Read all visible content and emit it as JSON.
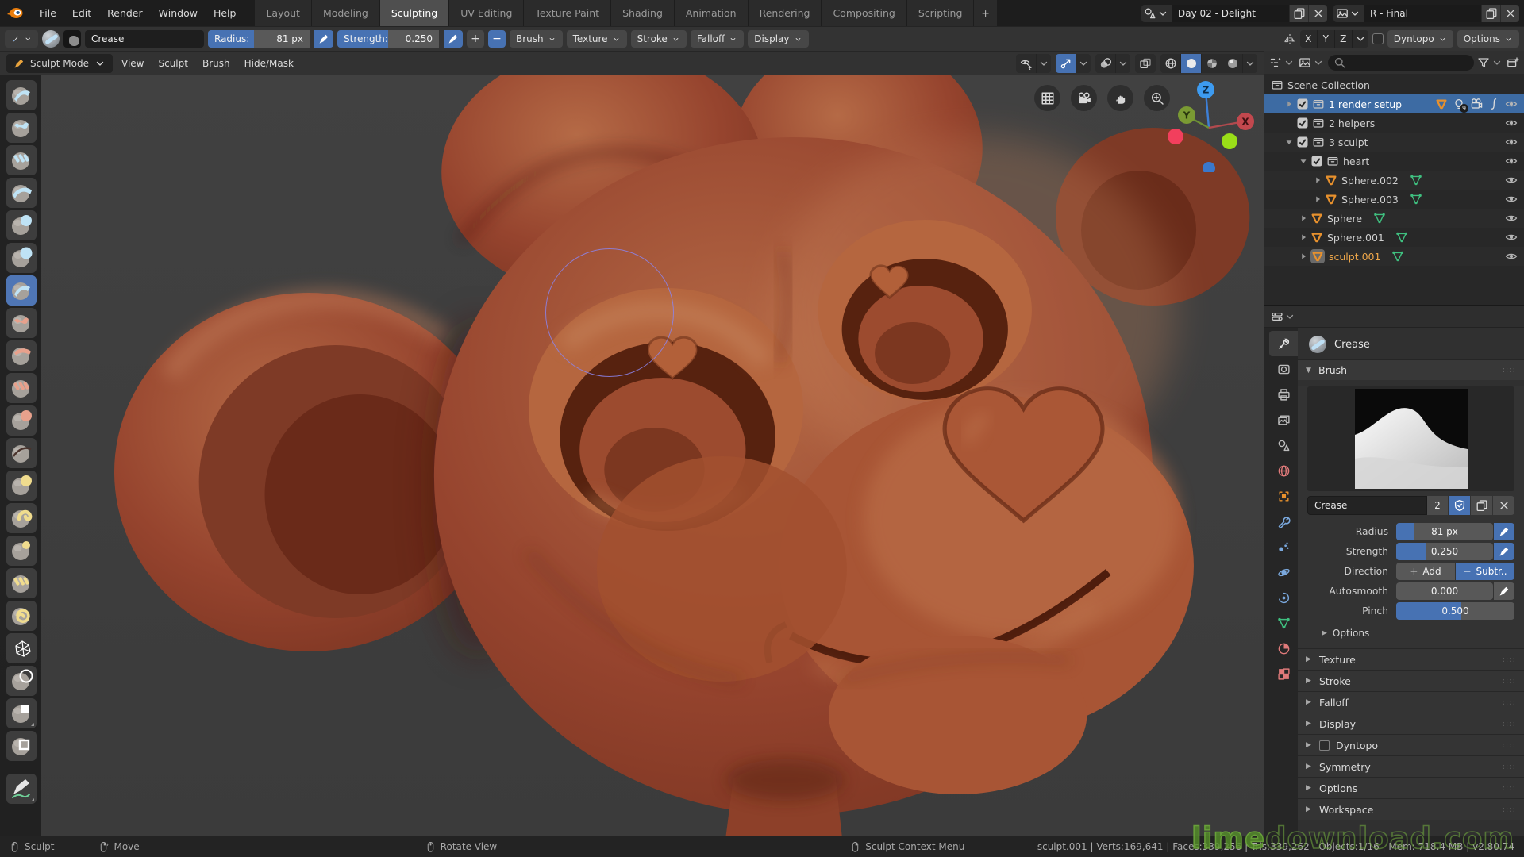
{
  "topbar": {
    "menus": [
      "File",
      "Edit",
      "Render",
      "Window",
      "Help"
    ],
    "workspace_tabs": [
      "Layout",
      "Modeling",
      "Sculpting",
      "UV Editing",
      "Texture Paint",
      "Shading",
      "Animation",
      "Rendering",
      "Compositing",
      "Scripting"
    ],
    "active_tab": "Sculpting",
    "add_tab_label": "+",
    "scene_name": "Day 02 - Delight",
    "view_layer_name": "R - Final"
  },
  "tool_header": {
    "tool_name": "Crease",
    "radius_label": "Radius:",
    "radius_value": "81 px",
    "radius_fill": 0.45,
    "strength_label": "Strength:",
    "strength_value": "0.250",
    "strength_fill": 0.5,
    "plus_label": "+",
    "minus_label": "−",
    "dropdowns": [
      "Brush",
      "Texture",
      "Stroke",
      "Falloff",
      "Display"
    ],
    "mirror_axes": [
      "X",
      "Y",
      "Z"
    ],
    "dyntopo_label": "Dyntopo",
    "options_label": "Options"
  },
  "viewport_header": {
    "mode": "Sculpt Mode",
    "menus": [
      "View",
      "Sculpt",
      "Brush",
      "Hide/Mask"
    ]
  },
  "toolbar": {
    "tools": [
      {
        "name": "draw",
        "accent": "blue",
        "kind": "stripe"
      },
      {
        "name": "clay",
        "accent": "blue",
        "kind": "squiggle"
      },
      {
        "name": "clay-strips",
        "accent": "blue",
        "kind": "strips"
      },
      {
        "name": "layer",
        "accent": "blue",
        "kind": "band"
      },
      {
        "name": "inflate",
        "accent": "blue",
        "kind": "cap"
      },
      {
        "name": "blob",
        "accent": "blue",
        "kind": "ball"
      },
      {
        "name": "crease",
        "accent": "blue",
        "kind": "stripe",
        "active": true
      },
      {
        "name": "smooth",
        "accent": "red",
        "kind": "squiggle"
      },
      {
        "name": "flatten",
        "accent": "red",
        "kind": "flat"
      },
      {
        "name": "fill",
        "accent": "red",
        "kind": "strips"
      },
      {
        "name": "scrape",
        "accent": "red",
        "kind": "cap"
      },
      {
        "name": "pinch",
        "accent": "dark",
        "kind": "line"
      },
      {
        "name": "grab",
        "accent": "yellow",
        "kind": "cap"
      },
      {
        "name": "snake-hook",
        "accent": "yellow",
        "kind": "hook"
      },
      {
        "name": "thumb",
        "accent": "yellow",
        "kind": "smallcap"
      },
      {
        "name": "nudge",
        "accent": "yellow",
        "kind": "strips"
      },
      {
        "name": "rotate",
        "accent": "yellow",
        "kind": "swirl"
      },
      {
        "name": "simplify",
        "accent": "white",
        "kind": "mesh"
      },
      {
        "name": "mask",
        "accent": "white",
        "kind": "ball"
      },
      {
        "name": "box-mask",
        "accent": "white",
        "kind": "sqcorner",
        "more": true
      },
      {
        "name": "box-hide",
        "accent": "white",
        "kind": "square"
      },
      {
        "name": "annotate",
        "accent": "pen",
        "kind": "pen",
        "more": true,
        "gap": true
      }
    ]
  },
  "outliner": {
    "root_label": "Scene Collection",
    "rows": [
      {
        "label": "1 render setup",
        "indent": 1,
        "expander": "right",
        "checkbox": true,
        "icon": "box",
        "selected": true,
        "extras": [
          "mesh",
          "bulb9",
          "cam",
          "fcurve"
        ],
        "badge": "9",
        "eye": true
      },
      {
        "label": "2 helpers",
        "indent": 1,
        "expander": "none",
        "checkbox": true,
        "icon": "box",
        "eye": true
      },
      {
        "label": "3 sculpt",
        "indent": 1,
        "expander": "down",
        "checkbox": true,
        "icon": "box",
        "eye": true
      },
      {
        "label": "heart",
        "indent": 2,
        "expander": "down",
        "checkbox": true,
        "icon": "box",
        "eye": true
      },
      {
        "label": "Sphere.002",
        "indent": 3,
        "expander": "right",
        "icon": "mesh",
        "data_icon": true,
        "eye": true
      },
      {
        "label": "Sphere.003",
        "indent": 3,
        "expander": "right",
        "icon": "mesh",
        "data_icon": true,
        "eye": true
      },
      {
        "label": "Sphere",
        "indent": 2,
        "expander": "right",
        "icon": "mesh",
        "data_icon": true,
        "eye": true
      },
      {
        "label": "Sphere.001",
        "indent": 2,
        "expander": "right",
        "icon": "mesh",
        "data_icon": true,
        "eye": true
      },
      {
        "label": "sculpt.001",
        "indent": 2,
        "expander": "right",
        "icon": "mesh",
        "data_icon": true,
        "eye": true,
        "active": true
      }
    ]
  },
  "properties": {
    "tabs": [
      {
        "name": "tool",
        "active": true
      },
      {
        "name": "render"
      },
      {
        "name": "output"
      },
      {
        "name": "view-layer"
      },
      {
        "name": "scene"
      },
      {
        "name": "world"
      },
      {
        "name": "object"
      },
      {
        "name": "modifiers"
      },
      {
        "name": "particles"
      },
      {
        "name": "physics"
      },
      {
        "name": "constraints"
      },
      {
        "name": "object-data"
      },
      {
        "name": "material"
      },
      {
        "name": "texture"
      }
    ],
    "title": "Crease",
    "brush_panel_label": "Brush",
    "id_name": "Crease",
    "id_users": "2",
    "fields": [
      {
        "label": "Radius",
        "value": "81 px",
        "fill": 0.18,
        "pressure": true,
        "pressure_on": true
      },
      {
        "label": "Strength",
        "value": "0.250",
        "fill": 0.3,
        "pressure": true,
        "pressure_on": true
      },
      {
        "label": "Direction",
        "type": "buttons",
        "options": [
          {
            "sign": "+",
            "label": "Add",
            "active": false
          },
          {
            "sign": "−",
            "label": "Subtr..",
            "active": true
          }
        ]
      },
      {
        "label": "Autosmooth",
        "value": "0.000",
        "fill": 0,
        "pressure": true,
        "pressure_on": false
      },
      {
        "label": "Pinch",
        "value": "0.500",
        "fill": 0.55
      }
    ],
    "sub_panel": "Options",
    "collapsed_panels": [
      {
        "label": "Texture"
      },
      {
        "label": "Stroke"
      },
      {
        "label": "Falloff"
      },
      {
        "label": "Display"
      },
      {
        "label": "Dyntopo",
        "checkbox": true
      },
      {
        "label": "Symmetry"
      },
      {
        "label": "Options"
      },
      {
        "label": "Workspace"
      }
    ]
  },
  "statusbar": {
    "left": [
      {
        "mouse": "lmb",
        "label": "Sculpt"
      },
      {
        "mouse": "rmbd",
        "label": "Move"
      },
      {
        "mouse": "mmb",
        "label": "Rotate View"
      },
      {
        "mouse": "rmb",
        "label": "Sculpt Context Menu"
      }
    ],
    "right": "sculpt.001 | Verts:169,641 | Faces:339,256 | Tris:339,262 | Objects:1/16 | Mem: 718.4 MB | v2.80.74"
  },
  "watermark": {
    "solid": "lime",
    "outline": "download.com"
  },
  "colors": {
    "accent_blue": "#4772b3",
    "selection_blue": "#3d6ba3",
    "object_orange": "#e8912d",
    "data_green": "#3fbf7f",
    "active_text_orange": "#eca549",
    "clay_base": "#96442e"
  }
}
